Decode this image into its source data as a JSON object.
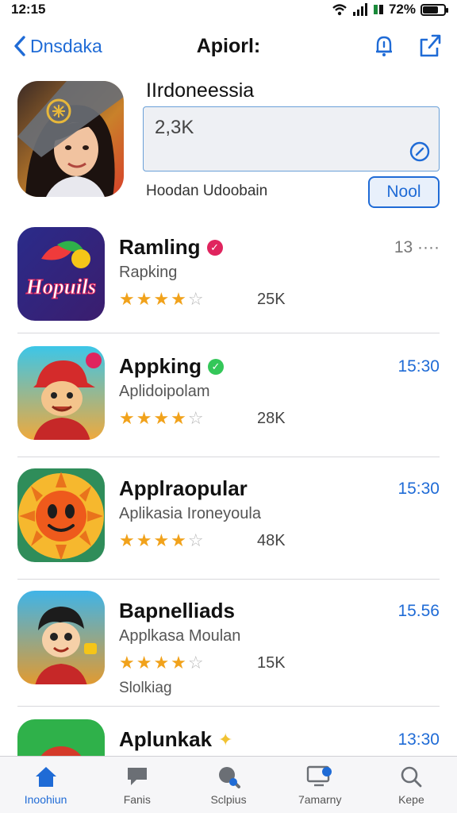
{
  "status_bar": {
    "time": "12:15",
    "battery": "72%"
  },
  "nav": {
    "back_label": "Dnsdaka",
    "title": "Apiorl:"
  },
  "featured": {
    "title": "IIrdoneessia",
    "input_value": "2,3K",
    "subtitle": "Hoodan Udoobain",
    "button_label": "Nool"
  },
  "apps": [
    {
      "name": "Ramling",
      "subtitle": "Rapking",
      "rating": 4,
      "count": "25K",
      "time": "13 ····",
      "badge_color": "#e0245e",
      "icon_text": "Hopuils"
    },
    {
      "name": "Appking",
      "subtitle": "Aplidoipolam",
      "rating": 4,
      "count": "28K",
      "time": "15:30",
      "badge_color": "#34c759"
    },
    {
      "name": "Applraopular",
      "subtitle": "Aplikasia Ironeyoula",
      "rating": 4,
      "count": "48K",
      "time": "15:30"
    },
    {
      "name": "Bapnelliads",
      "subtitle": "Applkasa Moulan",
      "rating": 4,
      "count": "15K",
      "time": "15.56",
      "extra": "Slolkiag"
    },
    {
      "name": "Aplunkak",
      "subtitle": "",
      "rating": 0,
      "count": "",
      "time": "13:30"
    }
  ],
  "tabs": [
    {
      "label": "Inoohiun",
      "icon": "home-icon"
    },
    {
      "label": "Fanis",
      "icon": "chat-icon"
    },
    {
      "label": "Sclpius",
      "icon": "search-magnify-icon"
    },
    {
      "label": "7amarny",
      "icon": "monitor-icon"
    },
    {
      "label": "Kepe",
      "icon": "search-icon"
    }
  ],
  "colors": {
    "accent": "#1f6bd6",
    "star": "#f1a21b"
  }
}
